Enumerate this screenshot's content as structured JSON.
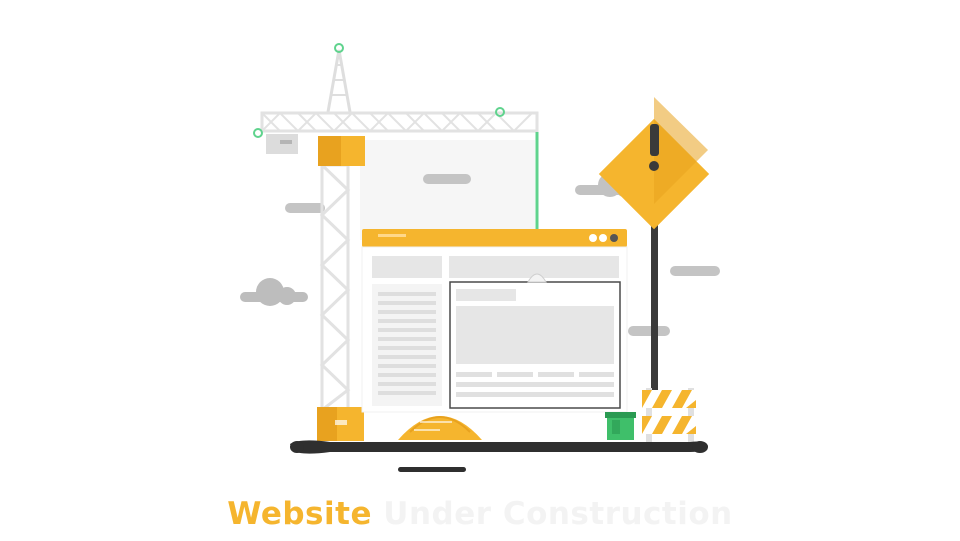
{
  "caption": {
    "word1": "Website",
    "word2": " Under Construction"
  },
  "colors": {
    "accent": "#f5b52e",
    "accent_dark": "#e8a21f",
    "green": "#5fd38d",
    "gray": "#bdbdbd",
    "dark": "#3a3a3a",
    "light": "#ececec"
  },
  "icons": [
    "crane-icon",
    "warning-sign-icon",
    "cloud-icon",
    "browser-window-icon",
    "barricade-icon",
    "sand-pile-icon",
    "paint-bucket-icon"
  ]
}
